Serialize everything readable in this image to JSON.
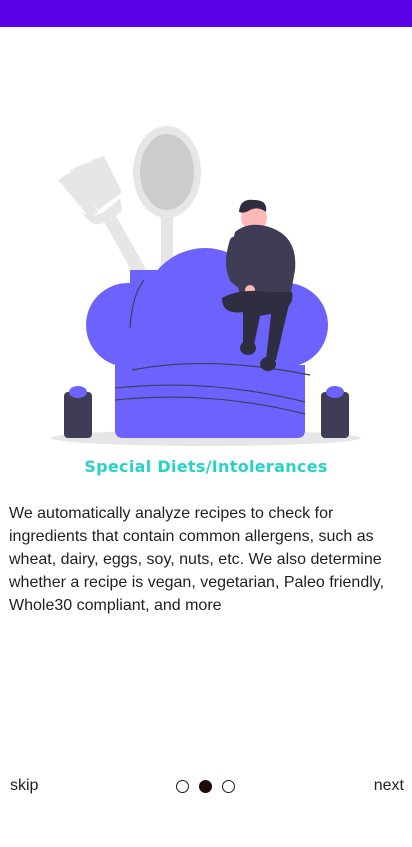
{
  "onboarding": {
    "title": "Special Diets/Intolerances",
    "description": "We automatically analyze recipes to check for ingredients that contain common allergens, such as wheat, dairy, eggs, soy, nuts, etc. We also determine whether a recipe is vegan, vegetarian, Paleo friendly, Whole30 compliant, and more",
    "illustration": "chef-hat-with-person-and-utensils",
    "page_indicator": {
      "total": 3,
      "active_index": 1
    }
  },
  "nav": {
    "skip_label": "skip",
    "next_label": "next"
  },
  "colors": {
    "status_bar": "#5b00e6",
    "title": "#27d3c4",
    "accent": "#6c63ff",
    "dark": "#3f3d56"
  }
}
